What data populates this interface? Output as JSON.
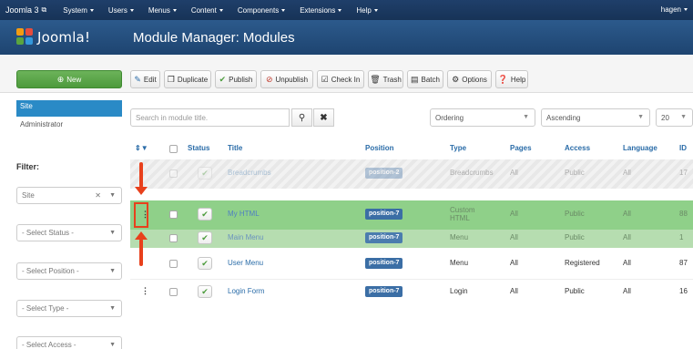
{
  "topbar": {
    "brand": "Joomla 3",
    "menus": [
      "System",
      "Users",
      "Menus",
      "Content",
      "Components",
      "Extensions",
      "Help"
    ],
    "user": "hagen"
  },
  "header": {
    "logo_text": "Joomla!",
    "title": "Module Manager: Modules"
  },
  "toolbar": {
    "new": "New",
    "edit": "Edit",
    "duplicate": "Duplicate",
    "publish": "Publish",
    "unpublish": "Unpublish",
    "checkin": "Check In",
    "trash": "Trash",
    "batch": "Batch",
    "options": "Options",
    "help": "Help"
  },
  "sidebar": {
    "site": "Site",
    "administrator": "Administrator",
    "filter_label": "Filter:",
    "site_filter": "Site",
    "select_status": "- Select Status -",
    "select_position": "- Select Position -",
    "select_type": "- Select Type -",
    "select_access": "- Select Access -"
  },
  "search": {
    "placeholder": "Search in module title."
  },
  "sort": {
    "ordering": "Ordering",
    "direction": "Ascending",
    "limit": "20"
  },
  "columns": {
    "status": "Status",
    "title": "Title",
    "position": "Position",
    "type": "Type",
    "pages": "Pages",
    "access": "Access",
    "language": "Language",
    "id": "ID"
  },
  "rows": [
    {
      "title": "Breadcrumbs",
      "position": "position-2",
      "type": "Breadcrumbs",
      "pages": "All",
      "access": "Public",
      "language": "All",
      "id": "17"
    },
    {
      "title": "My HTML",
      "position": "position-7",
      "type": "Custom HTML",
      "pages": "All",
      "access": "Public",
      "language": "All",
      "id": "88"
    },
    {
      "title": "Main Menu",
      "position": "position-7",
      "type": "Menu",
      "pages": "All",
      "access": "Public",
      "language": "All",
      "id": "1"
    },
    {
      "title": "User Menu",
      "position": "position-7",
      "type": "Menu",
      "pages": "All",
      "access": "Registered",
      "language": "All",
      "id": "87"
    },
    {
      "title": "Login Form",
      "position": "position-7",
      "type": "Login",
      "pages": "All",
      "access": "Public",
      "language": "All",
      "id": "16"
    }
  ],
  "colors": {
    "topbar": "#173357",
    "header": "#1e4470",
    "new_button": "#4d9a3c",
    "active_sidebar": "#2a8ac6",
    "drag_row": "#8fd089",
    "annotation": "#e8401c"
  }
}
